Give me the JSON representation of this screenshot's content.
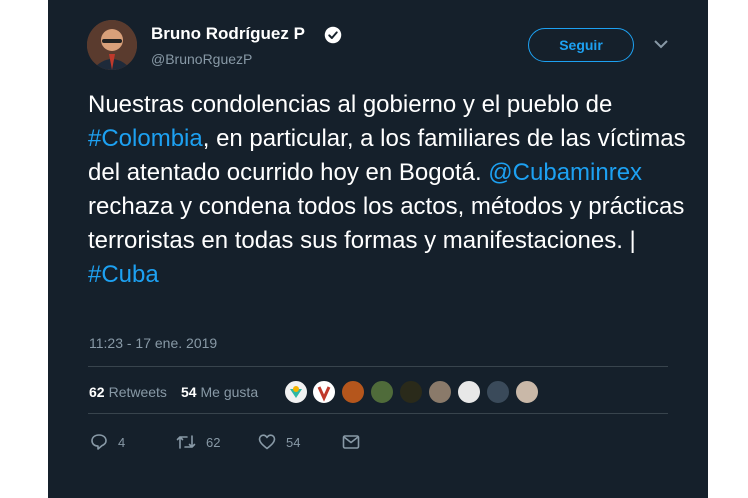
{
  "user": {
    "name": "Bruno Rodríguez P",
    "handle": "@BrunoRguezP"
  },
  "follow_label": "Seguir",
  "tweet": {
    "part1": "Nuestras condolencias al gobierno y el pueblo de ",
    "hashtag1": "#Colombia",
    "part2": ", en particular, a los familiares de las víctimas del atentado ocurrido hoy en Bogotá. ",
    "mention": "@Cubaminrex",
    "part3": " rechaza y condena todos los actos, métodos y prácticas terroristas en todas sus formas y manifestaciones. | ",
    "hashtag2": "#Cuba"
  },
  "timestamp": "11:23 - 17 ene. 2019",
  "stats": {
    "retweets_count": "62",
    "retweets_label": "Retweets",
    "likes_count": "54",
    "likes_label": "Me gusta"
  },
  "actions": {
    "replies": "4",
    "retweets": "62",
    "likes": "54"
  },
  "colors": {
    "background": "#15202b",
    "accent": "#1da1f2",
    "muted": "#8899a6"
  }
}
